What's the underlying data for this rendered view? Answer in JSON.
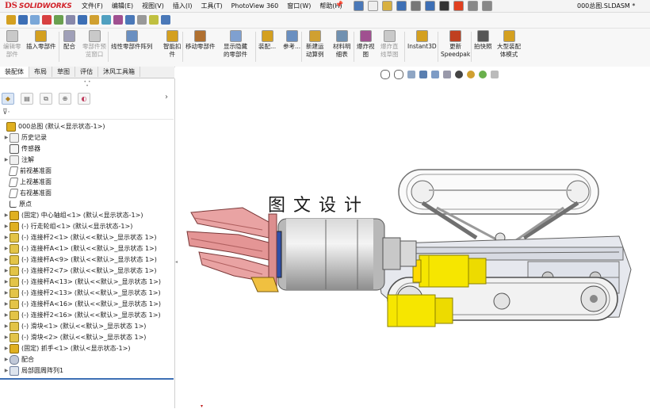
{
  "app": {
    "logo_ds": "DS",
    "logo_text": "SOLIDWORKS",
    "document_title": "000总图.SLDASM *"
  },
  "menu": [
    "文件(F)",
    "编辑(E)",
    "视图(V)",
    "插入(I)",
    "工具(T)",
    "PhotoView 360",
    "窗口(W)",
    "帮助(H)"
  ],
  "quick_icons": [
    "home-icon",
    "new-document-icon",
    "open-icon",
    "save-icon",
    "print-icon",
    "undo-icon",
    "select-arrow-icon",
    "rebuild-icon",
    "file-properties-icon",
    "options-gear-icon"
  ],
  "commands": [
    {
      "id": "edit-component",
      "l1": "编辑零",
      "l2": "部件",
      "disabled": true,
      "icon": "edit-component-icon"
    },
    {
      "id": "insert-component",
      "l1": "插入零部件",
      "l2": "",
      "disabled": false,
      "icon": "insert-component-icon"
    },
    {
      "id": "mate",
      "l1": "配合",
      "l2": "",
      "disabled": false,
      "icon": "mate-icon"
    },
    {
      "id": "component-preview",
      "l1": "零部件预",
      "l2": "览窗口",
      "disabled": true,
      "icon": "preview-window-icon"
    },
    {
      "id": "linear-pattern",
      "l1": "线性零部件阵列",
      "l2": "",
      "disabled": false,
      "icon": "linear-pattern-icon"
    },
    {
      "id": "smart-fastener",
      "l1": "智能扣",
      "l2": "件",
      "disabled": false,
      "icon": "smart-fastener-icon"
    },
    {
      "id": "move-component",
      "l1": "移动零部件",
      "l2": "",
      "disabled": false,
      "icon": "move-component-icon"
    },
    {
      "id": "show-hidden",
      "l1": "显示隐藏",
      "l2": "的零部件",
      "disabled": false,
      "icon": "show-hidden-icon"
    },
    {
      "id": "assembly-feature",
      "l1": "装配...",
      "l2": "",
      "disabled": false,
      "icon": "assembly-feature-icon"
    },
    {
      "id": "reference-geometry",
      "l1": "参考...",
      "l2": "",
      "disabled": false,
      "icon": "reference-geometry-icon"
    },
    {
      "id": "new-motion-study",
      "l1": "新建运",
      "l2": "动算例",
      "disabled": false,
      "icon": "motion-study-icon"
    },
    {
      "id": "bill-of-materials",
      "l1": "材料明",
      "l2": "细表",
      "disabled": false,
      "icon": "bom-icon"
    },
    {
      "id": "exploded-view",
      "l1": "爆炸视",
      "l2": "图",
      "disabled": false,
      "icon": "exploded-view-icon"
    },
    {
      "id": "explode-line-sketch",
      "l1": "爆炸直",
      "l2": "线草图",
      "disabled": true,
      "icon": "explode-line-icon"
    },
    {
      "id": "instant3d",
      "l1": "Instant3D",
      "l2": "",
      "disabled": false,
      "icon": "instant3d-icon"
    },
    {
      "id": "update-speedpak",
      "l1": "更新",
      "l2": "Speedpak",
      "disabled": false,
      "icon": "speedpak-icon"
    },
    {
      "id": "snapshot",
      "l1": "拍快照",
      "l2": "",
      "disabled": false,
      "icon": "camera-icon"
    },
    {
      "id": "large-assembly-mode",
      "l1": "大型装配",
      "l2": "体模式",
      "disabled": false,
      "icon": "large-assembly-icon"
    }
  ],
  "tabs": [
    "装配体",
    "布局",
    "草图",
    "评估",
    "沐风工具箱"
  ],
  "tree": [
    {
      "label": "000总图  (默认<显示状态-1>)",
      "icon": "asm",
      "exp": "",
      "indent": 0
    },
    {
      "label": "历史记录",
      "icon": "folder",
      "exp": "▶",
      "indent": 1
    },
    {
      "label": "传感器",
      "icon": "sensor",
      "exp": "",
      "indent": 1
    },
    {
      "label": "注解",
      "icon": "folder",
      "exp": "▶",
      "indent": 1
    },
    {
      "label": "前视基准面",
      "icon": "plane",
      "exp": "",
      "indent": 1
    },
    {
      "label": "上视基准面",
      "icon": "plane",
      "exp": "",
      "indent": 1
    },
    {
      "label": "右视基准面",
      "icon": "plane",
      "exp": "",
      "indent": 1
    },
    {
      "label": "原点",
      "icon": "origin",
      "exp": "",
      "indent": 1
    },
    {
      "label": "(固定) 中心轴组<1> (默认<显示状态-1>)",
      "icon": "asm",
      "exp": "▶",
      "indent": 1
    },
    {
      "label": "(-) 行走轮组<1> (默认<显示状态-1>)",
      "icon": "asm",
      "exp": "▶",
      "indent": 1
    },
    {
      "label": "(-) 连接杆2<1> (默认<<默认>_显示状态 1>)",
      "icon": "part",
      "exp": "▶",
      "indent": 1
    },
    {
      "label": "(-) 连接杆A<1> (默认<<默认>_显示状态 1>)",
      "icon": "part",
      "exp": "▶",
      "indent": 1
    },
    {
      "label": "(-) 连接杆A<9> (默认<<默认>_显示状态 1>)",
      "icon": "part",
      "exp": "▶",
      "indent": 1
    },
    {
      "label": "(-) 连接杆2<7> (默认<<默认>_显示状态 1>)",
      "icon": "part",
      "exp": "▶",
      "indent": 1
    },
    {
      "label": "(-) 连接杆A<13> (默认<<默认>_显示状态 1>)",
      "icon": "part",
      "exp": "▶",
      "indent": 1
    },
    {
      "label": "(-) 连接杆2<13> (默认<<默认>_显示状态 1>)",
      "icon": "part",
      "exp": "▶",
      "indent": 1
    },
    {
      "label": "(-) 连接杆A<16> (默认<<默认>_显示状态 1>)",
      "icon": "part",
      "exp": "▶",
      "indent": 1
    },
    {
      "label": "(-) 连接杆2<16> (默认<<默认>_显示状态 1>)",
      "icon": "part",
      "exp": "▶",
      "indent": 1
    },
    {
      "label": "(-) 滑块<1> (默认<<默认>_显示状态 1>)",
      "icon": "part",
      "exp": "▶",
      "indent": 1
    },
    {
      "label": "(-) 滑块<2> (默认<<默认>_显示状态 1>)",
      "icon": "part",
      "exp": "▶",
      "indent": 1
    },
    {
      "label": "(固定) 抓手<1> (默认<显示状态-1>)",
      "icon": "asm",
      "exp": "▶",
      "indent": 1
    },
    {
      "label": "配合",
      "icon": "mate",
      "exp": "▶",
      "indent": 1
    },
    {
      "label": "局部圆周阵列1",
      "icon": "pattern",
      "exp": "▶",
      "indent": 1
    }
  ],
  "watermark": "图文设计",
  "colors": {
    "brand_red": "#d2232a",
    "accent_blue": "#3d6fb5",
    "gripper_pink": "#e89d9d",
    "motor_yellow": "#f5e500",
    "body_gray": "#9a9a9a"
  }
}
